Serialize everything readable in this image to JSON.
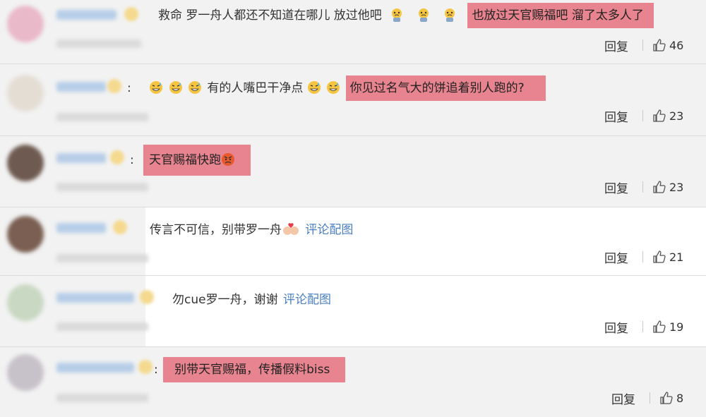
{
  "comments": [
    {
      "text_pre": "救命 罗一舟人都还不知道在哪儿 放过他吧",
      "highlight": "也放过天官赐福吧 溜了太多人了",
      "reply": "回复",
      "likes": "46"
    },
    {
      "colon": ":",
      "text_pre": "有的人嘴巴干净点",
      "highlight": "你见过名气大的饼追着别人跑的?",
      "reply": "回复",
      "likes": "23"
    },
    {
      "colon": ":",
      "highlight": "天官赐福快跑",
      "reply": "回复",
      "likes": "23"
    },
    {
      "text_pre": "传言不可信，别带罗一舟",
      "link": "评论配图",
      "reply": "回复",
      "likes": "21"
    },
    {
      "text_pre": "勿cue罗一舟，谢谢",
      "link": "评论配图",
      "reply": "回复",
      "likes": "19"
    },
    {
      "colon": ":",
      "highlight": "别带天官赐福，传播假料biss",
      "reply": "回复",
      "likes": "8"
    }
  ],
  "icons": {
    "like": "thumbs-up-icon",
    "cry_emoji": "crying-face-icon",
    "sweat_emoji": "sweat-smile-icon",
    "angry_emoji": "angry-face-icon",
    "couple_emoji": "couple-heart-icon"
  },
  "colors": {
    "highlight": "#e8848f",
    "link": "#4a7fc1",
    "background": "#f2f2f2"
  }
}
